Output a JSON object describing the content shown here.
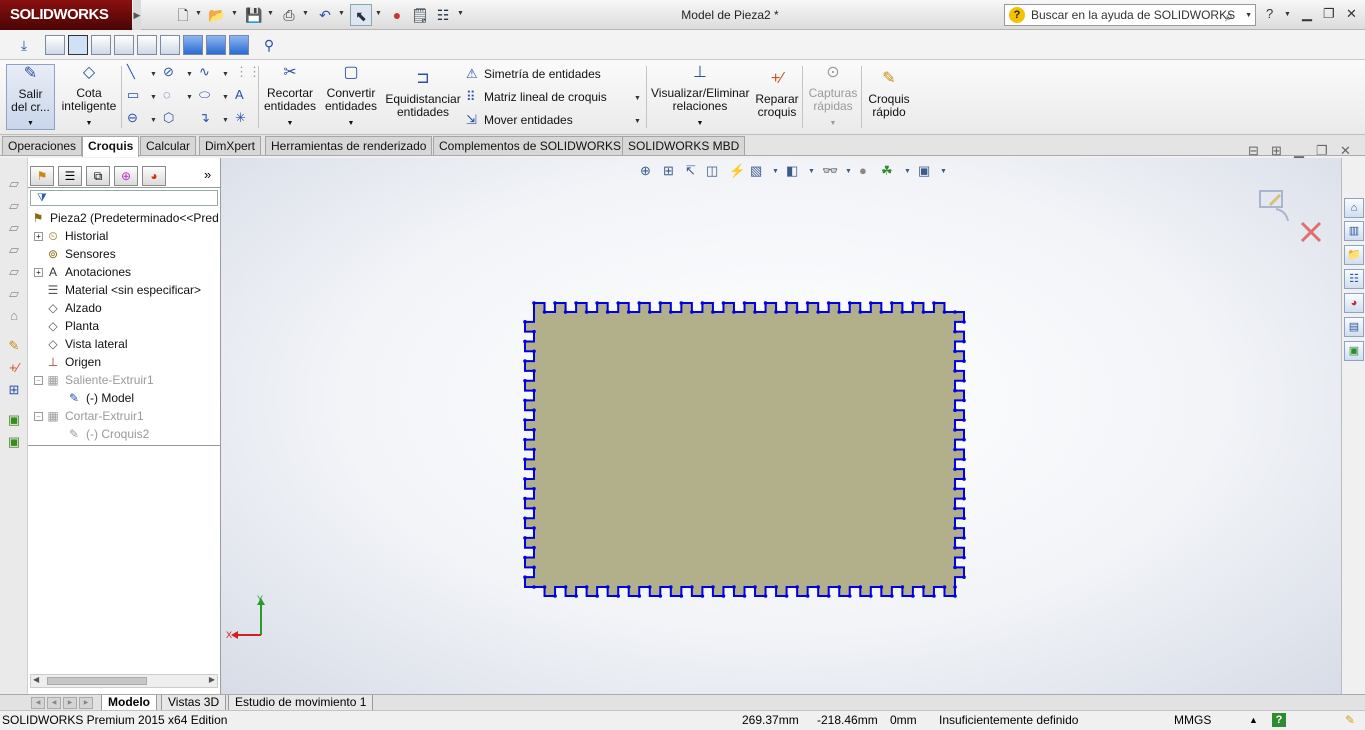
{
  "app": {
    "logo": "SOLIDWORKS",
    "document_title": "Model de Pieza2 *",
    "help_search_placeholder": "Buscar en la ayuda de SOLIDWORKS"
  },
  "ribbon": {
    "exit_sketch": "Salir\ndel cr...",
    "smart_dimension": "Cota\ninteligente",
    "trim": "Recortar\nentidades",
    "convert": "Convertir\nentidades",
    "offset": "Equidistanciar\nentidades",
    "mirror": "Simetría de entidades",
    "linear_pattern": "Matriz lineal de croquis",
    "move": "Mover entidades",
    "relations": "Visualizar/Eliminar\nrelaciones",
    "repair": "Reparar\ncroquis",
    "quick_snaps": "Capturas\nrápidas",
    "rapid_sketch": "Croquis\nrápido"
  },
  "tabs": [
    "Operaciones",
    "Croquis",
    "Calcular",
    "DimXpert",
    "Herramientas de renderizado",
    "Complementos de SOLIDWORKS",
    "SOLIDWORKS MBD"
  ],
  "active_tab": "Croquis",
  "tree": {
    "root": "Pieza2  (Predeterminado<<Pred",
    "items": [
      "Historial",
      "Sensores",
      "Anotaciones",
      "Material <sin especificar>",
      "Alzado",
      "Planta",
      "Vista lateral",
      "Origen",
      "Saliente-Extruir1",
      "(-) Model",
      "Cortar-Extruir1",
      "(-) Croquis2"
    ]
  },
  "triad": {
    "x_label": "X",
    "y_label": "Y"
  },
  "bottom_tabs": [
    "Modelo",
    "Vistas 3D",
    "Estudio de movimiento 1"
  ],
  "status": {
    "edition": "SOLIDWORKS Premium 2015 x64 Edition",
    "x": "269.37mm",
    "y": "-218.46mm",
    "z": "0mm",
    "state": "Insuficientemente definido",
    "units": "MMGS"
  },
  "colors": {
    "face": "#b2b08a",
    "sketch": "#0000e0",
    "logo_bg": "#7a0f0f"
  }
}
